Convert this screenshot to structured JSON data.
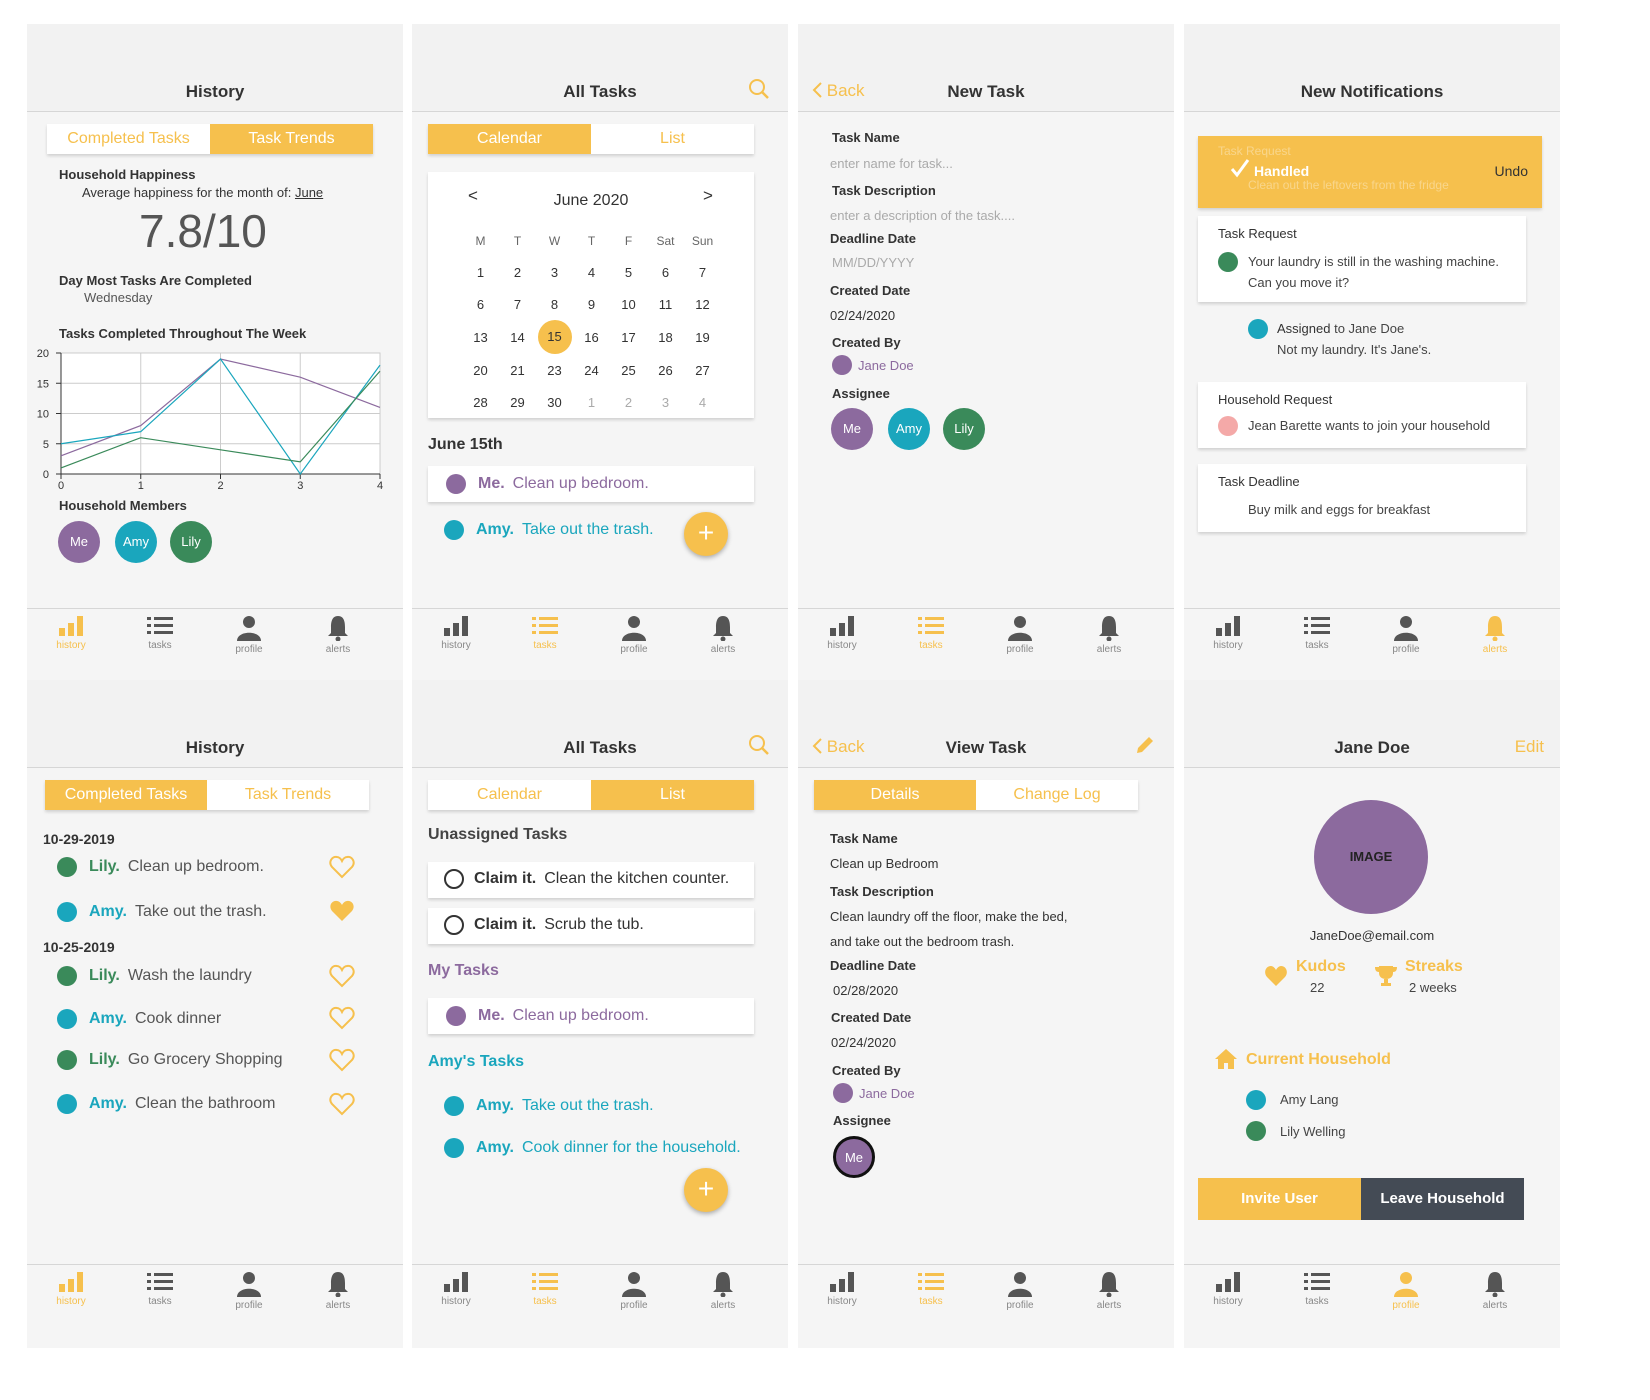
{
  "nav": {
    "history": "history",
    "tasks": "tasks",
    "profile": "profile",
    "alerts": "alerts"
  },
  "s1": {
    "title": "History",
    "seg": [
      "Completed Tasks",
      "Task Trends"
    ],
    "happiness_title": "Household Happiness",
    "happiness_sub": "Average  happiness for the month of:",
    "month": "June",
    "score": "7.8/10",
    "day_title": "Day Most Tasks Are Completed",
    "day": "Wednesday",
    "chart_title": "Tasks Completed Throughout The Week",
    "members_title": "Household Members",
    "members": [
      "Me",
      "Amy",
      "Lily"
    ]
  },
  "chart_data": {
    "type": "line",
    "title": "Tasks Completed Throughout The Week",
    "x": [
      0,
      1,
      2,
      3,
      4
    ],
    "xlim": [
      0,
      4
    ],
    "ylim": [
      0,
      20
    ],
    "yticks": [
      0,
      5,
      10,
      15,
      20
    ],
    "xticks": [
      0,
      1,
      2,
      3,
      4
    ],
    "grid": true,
    "series": [
      {
        "color": "#8c6a9e",
        "values": [
          3,
          8,
          19,
          16,
          11
        ]
      },
      {
        "color": "#1aa6bd",
        "values": [
          5,
          7,
          19,
          0,
          18
        ]
      },
      {
        "color": "#3a8a5a",
        "values": [
          1,
          6,
          4,
          2,
          17
        ]
      }
    ]
  },
  "s2": {
    "title": "All Tasks",
    "seg": [
      "Calendar",
      "List"
    ],
    "prev": "<",
    "next": ">",
    "month": "June 2020",
    "weekdays": [
      "M",
      "T",
      "W",
      "T",
      "F",
      "Sat",
      "Sun"
    ],
    "weeks": [
      [
        "1",
        "2",
        "3",
        "4",
        "5",
        "6",
        "7"
      ],
      [
        "6",
        "7",
        "8",
        "9",
        "10",
        "11",
        "12"
      ],
      [
        "13",
        "14",
        "15",
        "16",
        "17",
        "18",
        "19"
      ],
      [
        "20",
        "21",
        "23",
        "24",
        "25",
        "26",
        "27"
      ],
      [
        "28",
        "29",
        "30",
        "1",
        "2",
        "3",
        "4"
      ]
    ],
    "day_title": "June 15th",
    "tasks": [
      {
        "who": "Me.",
        "text": "Clean up bedroom."
      },
      {
        "who": "Amy.",
        "text": "Take out the trash."
      }
    ],
    "fab": "+"
  },
  "s3": {
    "back": "Back",
    "title": "New Task",
    "task_name": "Task Name",
    "task_name_ph": "enter name for task...",
    "desc": "Task Description",
    "desc_ph": "enter a description of the task....",
    "deadline": "Deadline Date",
    "deadline_ph": "MM/DD/YYYY",
    "created": "Created Date",
    "created_val": "02/24/2020",
    "created_by": "Created By",
    "created_by_val": "Jane Doe",
    "assignee": "Assignee",
    "assignees": [
      "Me",
      "Amy",
      "Lily"
    ]
  },
  "s4": {
    "title": "New Notifications",
    "handled": {
      "ghost_title": "Task Request",
      "label": "Handled",
      "ghost_text": "Clean out the leftovers from the fridge",
      "undo": "Undo"
    },
    "n1": {
      "title": "Task Request",
      "text1": "Your laundry is still in the washing machine.",
      "text2": "Can you move it?"
    },
    "n1r": {
      "bold": "Assigned",
      "rest": " to Jane Doe",
      "text": "Not my laundry. It's Jane's."
    },
    "n2": {
      "title": "Household Request",
      "text": "Jean Barette wants to join your household"
    },
    "n3": {
      "title": "Task Deadline",
      "text": "Buy milk and eggs for breakfast"
    }
  },
  "s5": {
    "title": "History",
    "seg": [
      "Completed Tasks",
      "Task Trends"
    ],
    "groups": [
      {
        "date": "10-29-2019",
        "items": [
          {
            "who": "Lily.",
            "text": "Clean up bedroom.",
            "liked": false
          },
          {
            "who": "Amy.",
            "text": "Take out the trash.",
            "liked": true
          }
        ]
      },
      {
        "date": "10-25-2019",
        "items": [
          {
            "who": "Lily.",
            "text": "Wash the laundry",
            "liked": false
          },
          {
            "who": "Amy.",
            "text": "Cook dinner",
            "liked": false
          },
          {
            "who": "Lily.",
            "text": "Go Grocery Shopping",
            "liked": false
          },
          {
            "who": "Amy.",
            "text": "Clean the bathroom",
            "liked": false
          }
        ]
      }
    ]
  },
  "s6": {
    "title": "All Tasks",
    "seg": [
      "Calendar",
      "List"
    ],
    "unassigned_title": "Unassigned Tasks",
    "claim": "Claim it.",
    "unassigned": [
      "Clean the kitchen counter.",
      "Scrub the tub."
    ],
    "my_title": "My Tasks",
    "my": {
      "who": "Me.",
      "text": "Clean up bedroom."
    },
    "amy_title": "Amy's Tasks",
    "amy": [
      {
        "who": "Amy.",
        "text": "Take out the trash."
      },
      {
        "who": "Amy.",
        "text": "Cook dinner for the household."
      }
    ],
    "fab": "+"
  },
  "s7": {
    "back": "Back",
    "title": "View Task",
    "seg": [
      "Details",
      "Change Log"
    ],
    "task_name": "Task Name",
    "task_name_val": "Clean up Bedroom",
    "desc": "Task Description",
    "desc_val1": "Clean laundry off the floor, make the bed,",
    "desc_val2": "and take out the bedroom trash.",
    "deadline": "Deadline Date",
    "deadline_val": "02/28/2020",
    "created": "Created Date",
    "created_val": "02/24/2020",
    "created_by": "Created By",
    "created_by_val": "Jane Doe",
    "assignee": "Assignee",
    "assignee_val": "Me"
  },
  "s8": {
    "title": "Jane Doe",
    "edit": "Edit",
    "image": "IMAGE",
    "email": "JaneDoe@email.com",
    "kudos": "Kudos",
    "kudos_val": "22",
    "streaks": "Streaks",
    "streaks_val": "2 weeks",
    "household_title": "Current Household",
    "members": [
      "Amy Lang",
      "Lily Welling"
    ],
    "invite": "Invite User",
    "leave": "Leave Household"
  },
  "colors": {
    "accent": "#f6c04d",
    "purple": "#8c6a9e",
    "teal": "#1aa6bd",
    "green": "#3a8a5a",
    "dark": "#444b55"
  }
}
